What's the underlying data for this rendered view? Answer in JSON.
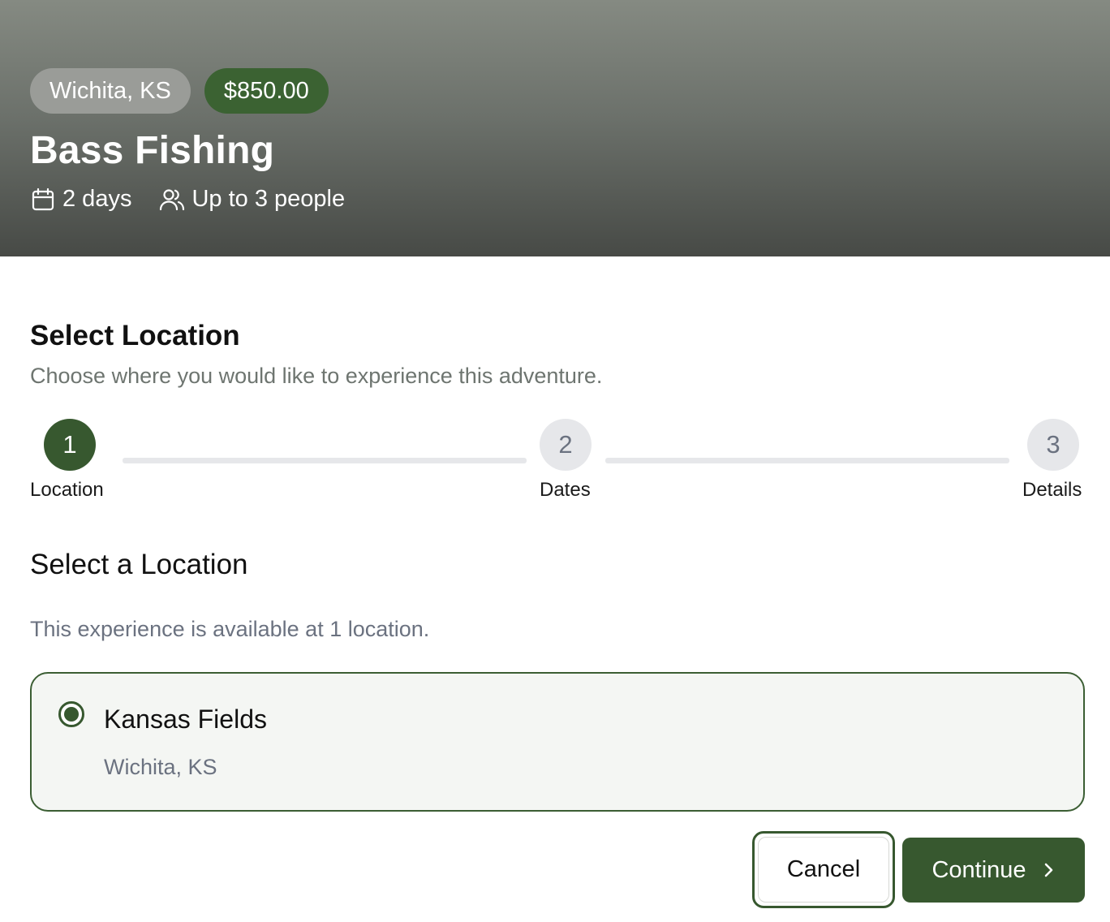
{
  "hero": {
    "location_badge": "Wichita, KS",
    "price_badge": "$850.00",
    "title": "Bass Fishing",
    "duration": "2 days",
    "capacity": "Up to 3 people",
    "duration_icon": "calendar-icon",
    "capacity_icon": "people-icon"
  },
  "section": {
    "title": "Select Location",
    "subtitle": "Choose where you would like to experience this adventure."
  },
  "stepper": {
    "current_step": 1,
    "steps": [
      {
        "number": "1",
        "label": "Location",
        "active": true
      },
      {
        "number": "2",
        "label": "Dates",
        "active": false
      },
      {
        "number": "3",
        "label": "Details",
        "active": false
      }
    ]
  },
  "locations": {
    "title": "Select a Location",
    "subtitle": "This experience is available at 1 location.",
    "items": [
      {
        "name": "Kansas Fields",
        "place": "Wichita, KS",
        "selected": true
      }
    ]
  },
  "actions": {
    "cancel_label": "Cancel",
    "continue_label": "Continue",
    "continue_icon": "chevron-right-icon"
  },
  "colors": {
    "accent": "#37582f",
    "price_badge": "#3b6232",
    "location_badge": "#9a9c98",
    "inactive_step": "#e6e7ea",
    "card_background": "#f4f6f3"
  }
}
